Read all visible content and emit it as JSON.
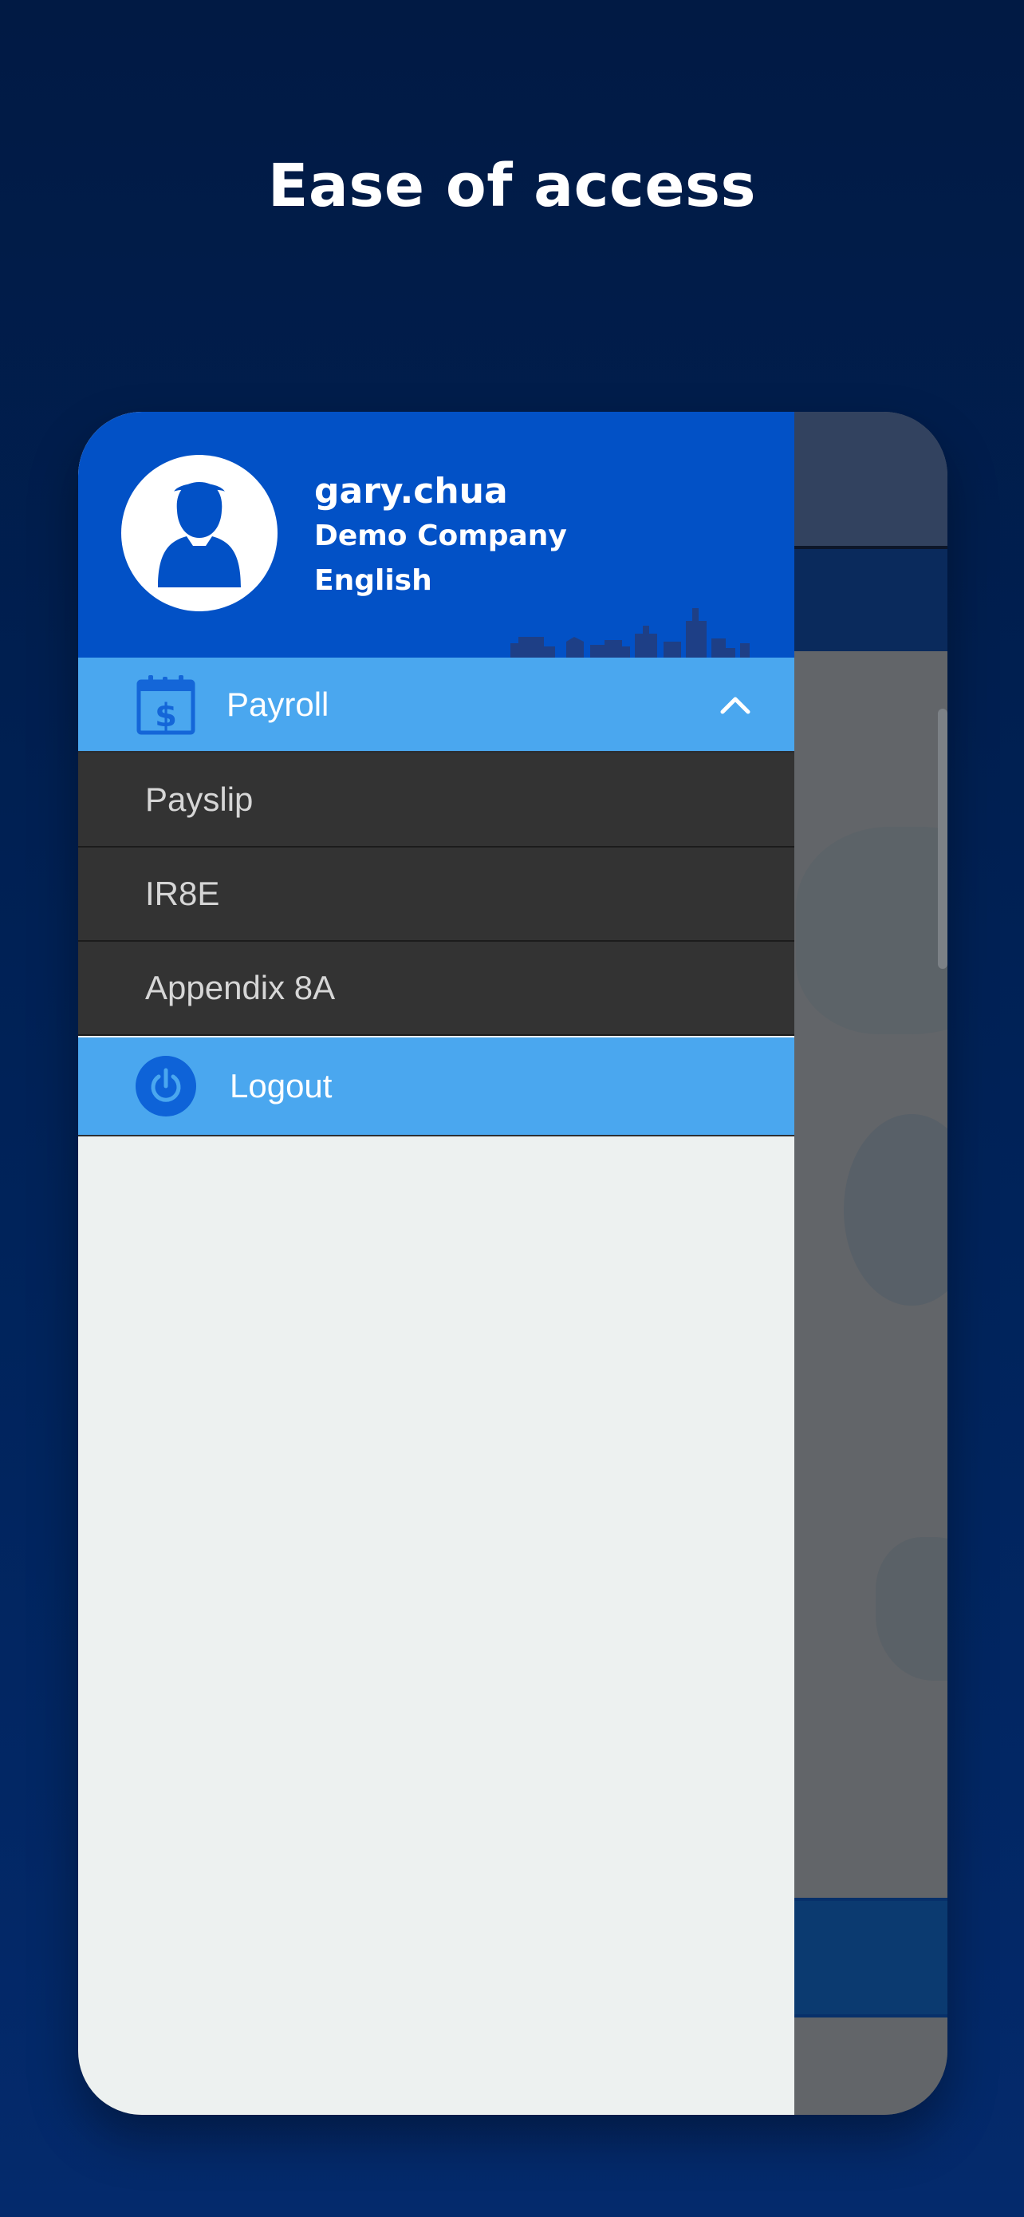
{
  "promo": {
    "headline": "Ease of access"
  },
  "drawer": {
    "user": {
      "username": "gary.chua",
      "company": "Demo Company",
      "language": "English",
      "avatar_icon": "user-avatar-icon"
    },
    "menu": {
      "payroll": {
        "label": "Payroll",
        "icon": "calendar-dollar-icon",
        "expanded": true,
        "items": [
          {
            "label": "Payslip"
          },
          {
            "label": "IR8E"
          },
          {
            "label": "Appendix 8A"
          }
        ]
      },
      "logout": {
        "label": "Logout",
        "icon": "power-icon"
      }
    }
  },
  "colors": {
    "background": "#011a44",
    "drawer_header": "#0251c6",
    "menu_highlight": "#4aa7ef",
    "submenu_bg": "#333333",
    "drawer_body": "#edf1f0"
  }
}
